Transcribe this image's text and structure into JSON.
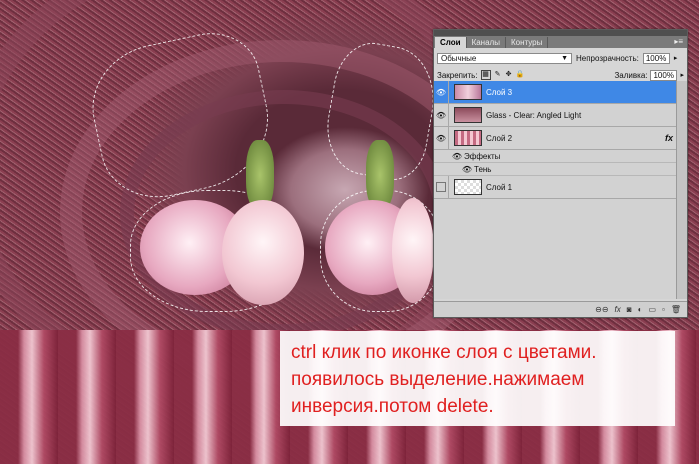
{
  "panel": {
    "tabs": [
      "Слои",
      "Каналы",
      "Контуры"
    ],
    "tabs_menu_icon": "panel-menu-icon",
    "blend_mode": "Обычные",
    "opacity_label": "Непрозрачность:",
    "opacity_value": "100%",
    "lock_label": "Закрепить:",
    "fill_label": "Заливка:",
    "fill_value": "100%",
    "layers": [
      {
        "name": "Слой 3",
        "selected": true,
        "visible": true
      },
      {
        "name": "Glass - Clear: Angled Light",
        "selected": false,
        "visible": true
      },
      {
        "name": "Слой 2",
        "selected": false,
        "visible": true,
        "fx": "fx"
      },
      {
        "name": "Слой 1",
        "selected": false,
        "visible": false
      }
    ],
    "effects_label": "Эффекты",
    "shadow_label": "Тень"
  },
  "note": {
    "line1": "ctrl клик по иконке слоя с цветами.",
    "line2": "появилось выделение.нажимаем",
    "line3": "инверсия.потом delete."
  }
}
